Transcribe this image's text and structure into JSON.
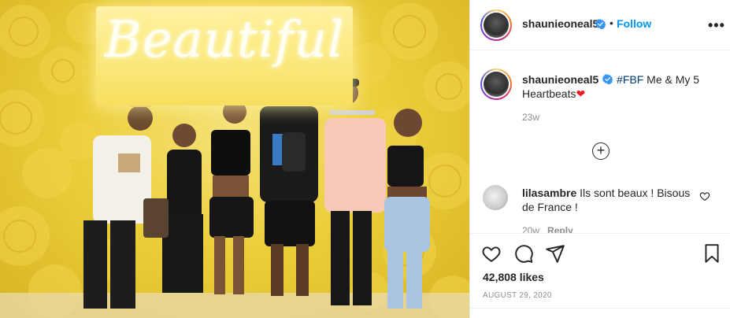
{
  "post": {
    "photo_sign_text": "Beautiful",
    "photo_alt": ""
  },
  "header": {
    "username": "shaunieoneal5",
    "separator": "•",
    "follow_label": "Follow",
    "more_label": "•••"
  },
  "caption": {
    "username": "shaunieoneal5",
    "text": "#FBF Me & My 5 Heartbeats",
    "hashtag": "#FBF",
    "body": " Me & My 5 Heartbeats",
    "emoji": "❤",
    "time": "23w"
  },
  "load_more": {
    "label": "+"
  },
  "comments": [
    {
      "username": "lilasambre",
      "text": "Ils sont beaux ! Bisous de France !",
      "time": "20w",
      "reply_label": "Reply"
    }
  ],
  "actions": {
    "likes": "42,808 likes",
    "date": "AUGUST 29, 2020"
  },
  "colors": {
    "follow_blue": "#0095f6",
    "verified_blue": "#3897f0",
    "heart_red": "#ed1c24",
    "muted_text": "#8e8e8e"
  },
  "icons": [
    "verified-badge-icon",
    "more-options-icon",
    "add-comment-icon",
    "like-heart-icon",
    "comment-bubble-icon",
    "share-send-icon",
    "save-bookmark-icon",
    "comment-like-icon"
  ]
}
